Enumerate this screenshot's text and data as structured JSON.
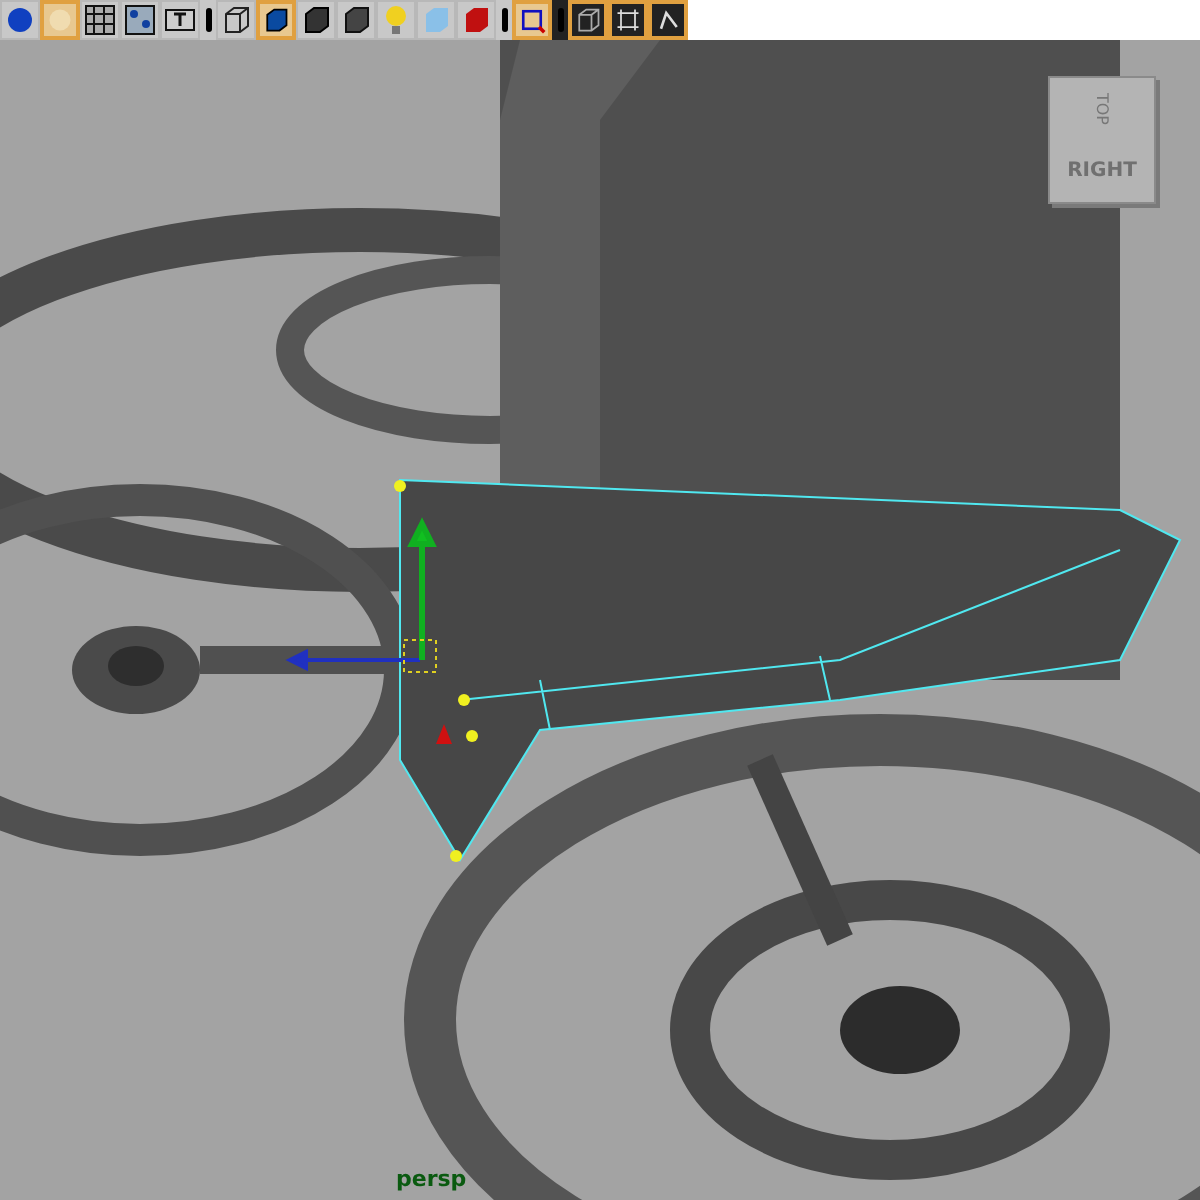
{
  "toolbar": {
    "items": [
      {
        "kind": "button",
        "selected": false
      },
      {
        "kind": "button",
        "selected": true
      },
      {
        "kind": "button",
        "selected": false
      },
      {
        "kind": "button",
        "selected": false
      },
      {
        "kind": "button",
        "selected": false
      },
      {
        "kind": "separator"
      },
      {
        "kind": "button",
        "selected": false
      },
      {
        "kind": "button",
        "selected": true
      },
      {
        "kind": "button",
        "selected": false
      },
      {
        "kind": "button",
        "selected": false
      },
      {
        "kind": "button",
        "selected": false
      },
      {
        "kind": "button",
        "selected": false
      },
      {
        "kind": "button",
        "selected": false
      },
      {
        "kind": "separator"
      },
      {
        "kind": "button",
        "selected": true
      },
      {
        "kind": "separator"
      },
      {
        "kind": "button",
        "selected": true
      },
      {
        "kind": "button",
        "selected": true
      },
      {
        "kind": "button",
        "selected": true
      }
    ]
  },
  "viewport": {
    "view_cube": {
      "top_label": "TOP",
      "front_label": "RIGHT"
    },
    "camera_label": "persp"
  }
}
